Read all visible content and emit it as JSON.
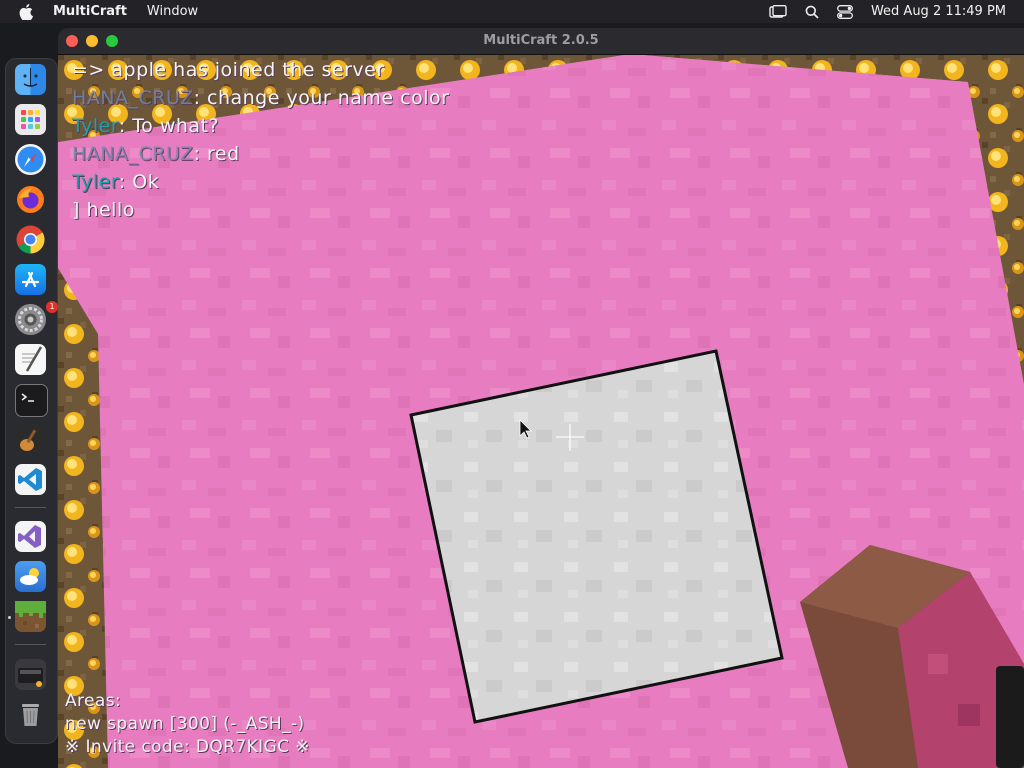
{
  "menubar": {
    "app_name": "MultiCraft",
    "menu_window": "Window",
    "clock": "Wed Aug 2  11:49 PM"
  },
  "window": {
    "title": "MultiCraft 2.0.5"
  },
  "dock": {
    "items": [
      {
        "icon": "finder-icon"
      },
      {
        "icon": "launchpad-icon"
      },
      {
        "icon": "safari-icon"
      },
      {
        "icon": "firefox-icon"
      },
      {
        "icon": "chrome-icon"
      },
      {
        "icon": "app-store-icon"
      },
      {
        "icon": "system-settings-icon",
        "badge": "1"
      },
      {
        "icon": "textedit-icon"
      },
      {
        "icon": "terminal-icon"
      },
      {
        "icon": "garageband-icon"
      },
      {
        "icon": "vscode-icon"
      },
      {
        "icon": "visual-studio-icon"
      },
      {
        "icon": "weather-icon"
      },
      {
        "icon": "multicraft-icon"
      },
      {
        "icon": "screenshot-icon"
      },
      {
        "icon": "trash-icon"
      }
    ]
  },
  "chat": [
    {
      "name": "",
      "text": "=> apple has joined the server"
    },
    {
      "name": "HANA_CRUZ",
      "text": ": change your name color"
    },
    {
      "name": "Tyler",
      "text": ": To what?"
    },
    {
      "name": "HANA_CRUZ",
      "text": ": red"
    },
    {
      "name": "Tyler",
      "text": ": Ok"
    },
    {
      "name": "",
      "text": "] hello"
    }
  ],
  "areas": {
    "heading": "Areas:",
    "entry": "new spawn [300] (-_ASH_-)",
    "invite": "※ Invite code: DQR7KIGC ※"
  },
  "colors": {
    "pink_wool": "#e77dc0",
    "white_wool": "#d6d6d6",
    "gold_ore": "#f2b51e",
    "name_teal": "#1fa1a6"
  }
}
